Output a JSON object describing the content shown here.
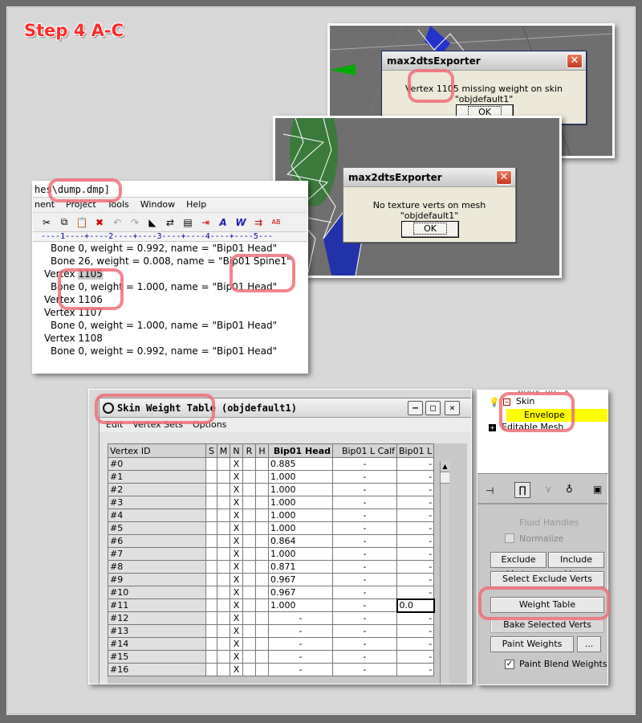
{
  "heading": "Step 4 A-C",
  "dialog1": {
    "title": "max2dtsExporter",
    "message": "Vertex 1105 missing weight on skin \"objdefault1\"",
    "ok": "OK"
  },
  "dialog2": {
    "title": "max2dtsExporter",
    "message": "No texture verts on mesh \"objdefault1\"",
    "ok": "OK"
  },
  "editor": {
    "title": "hes\\dump.dmp]",
    "menu": [
      "nent",
      "Project",
      "Tools",
      "Window",
      "Help"
    ],
    "ruler": "----1----+----2----+----3----+----4----+----5---",
    "lines": [
      {
        "text": "Bone 0, weight = 0.992, name =  \"Bip01 Head\"",
        "indent": true
      },
      {
        "text": "Bone 26, weight = 0.008, name =  \"Bip01 Spine1\"",
        "indent": true
      },
      {
        "text": "Vertex 1105",
        "indent": false
      },
      {
        "text": "Bone 0, weight = 1.000, name =  \"Bip01 Head\"",
        "indent": true
      },
      {
        "text": "Vertex 1106",
        "indent": false
      },
      {
        "text": "Vertex 1107",
        "indent": false
      },
      {
        "text": "Bone 0, weight = 1.000, name =  \"Bip01 Head\"",
        "indent": true
      },
      {
        "text": "Vertex 1108",
        "indent": false
      },
      {
        "text": "Bone 0, weight = 0.992, name =  \"Bip01 Head\"",
        "indent": true
      }
    ]
  },
  "skin_table": {
    "title": "Skin Weight Table (objdefault1)",
    "menu": [
      "Edit",
      "Vertex Sets",
      "Options"
    ],
    "headers": [
      "Vertex ID",
      "S",
      "M",
      "N",
      "R",
      "H",
      "Bip01 Head",
      "Bip01 L Calf",
      "Bip01 L"
    ],
    "rows": [
      {
        "id": "#0",
        "n": "X",
        "head": "0.885",
        "calf": "-",
        "l": "-"
      },
      {
        "id": "#1",
        "n": "X",
        "head": "1.000",
        "calf": "-",
        "l": "-"
      },
      {
        "id": "#2",
        "n": "X",
        "head": "1.000",
        "calf": "-",
        "l": "-"
      },
      {
        "id": "#3",
        "n": "X",
        "head": "1.000",
        "calf": "-",
        "l": "-"
      },
      {
        "id": "#4",
        "n": "X",
        "head": "1.000",
        "calf": "-",
        "l": "-"
      },
      {
        "id": "#5",
        "n": "X",
        "head": "1.000",
        "calf": "-",
        "l": "-"
      },
      {
        "id": "#6",
        "n": "X",
        "head": "0.864",
        "calf": "-",
        "l": "-"
      },
      {
        "id": "#7",
        "n": "X",
        "head": "1.000",
        "calf": "-",
        "l": "-"
      },
      {
        "id": "#8",
        "n": "X",
        "head": "0.871",
        "calf": "-",
        "l": "-"
      },
      {
        "id": "#9",
        "n": "X",
        "head": "0.967",
        "calf": "-",
        "l": "-"
      },
      {
        "id": "#10",
        "n": "X",
        "head": "0.967",
        "calf": "-",
        "l": "-"
      },
      {
        "id": "#11",
        "n": "X",
        "head": "1.000",
        "calf": "-",
        "l": "0.0"
      },
      {
        "id": "#12",
        "n": "X",
        "head": "-",
        "calf": "-",
        "l": "-"
      },
      {
        "id": "#13",
        "n": "X",
        "head": "-",
        "calf": "-",
        "l": "-"
      },
      {
        "id": "#14",
        "n": "X",
        "head": "-",
        "calf": "-",
        "l": "-"
      },
      {
        "id": "#15",
        "n": "X",
        "head": "-",
        "calf": "-",
        "l": "-"
      },
      {
        "id": "#16",
        "n": "X",
        "head": "-",
        "calf": "-",
        "l": "-"
      }
    ]
  },
  "modifier_panel": {
    "stack_top": "Body: un...k",
    "skin": "Skin",
    "envelope": "Envelope",
    "editable_mesh": "Editable Mesh",
    "fluid": "Fluid Handles",
    "normalize": "Normalize",
    "exclude": "Exclude Verts",
    "include": "Include Verts",
    "select_exclude": "Select Exclude Verts",
    "weight_table": "Weight Table",
    "bake": "Bake Selected Verts",
    "paint": "Paint Weights",
    "dots": "...",
    "paint_blend": "Paint Blend Weights"
  },
  "colors": {
    "highlight_ring": "#f06e78",
    "heading": "#ff2a2a",
    "envelope_bg": "#ffff00"
  }
}
